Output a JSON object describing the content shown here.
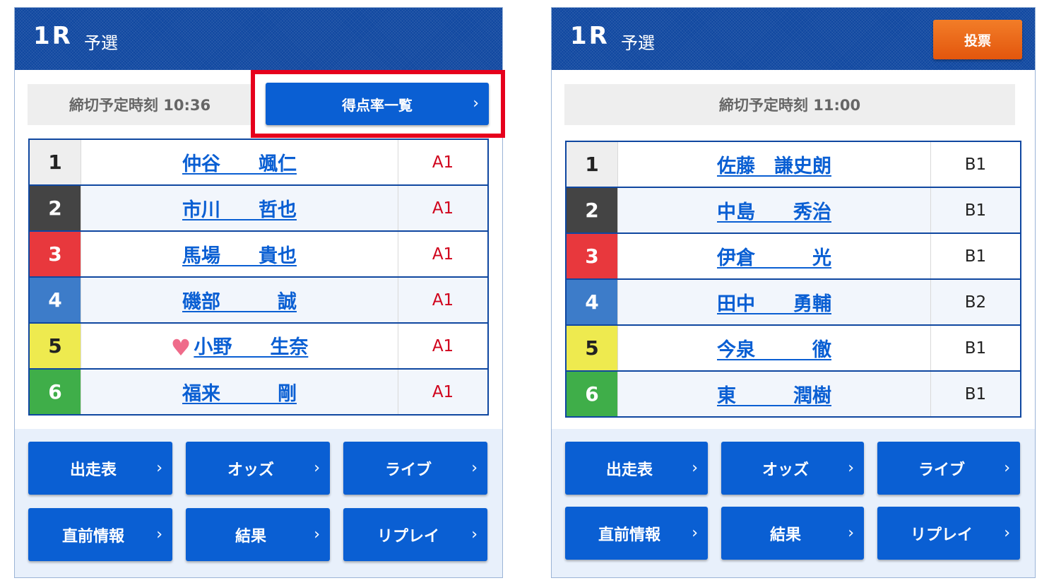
{
  "panels": [
    {
      "race_no": "1R",
      "race_name": "予選",
      "deadline": "締切予定時刻 10:36",
      "score_button": "得点率一覧",
      "entries": [
        {
          "waku": "1",
          "name": "仲谷　　颯仁",
          "grade": "A1",
          "favorite": false
        },
        {
          "waku": "2",
          "name": "市川　　哲也",
          "grade": "A1",
          "favorite": false
        },
        {
          "waku": "3",
          "name": "馬場　　貴也",
          "grade": "A1",
          "favorite": false
        },
        {
          "waku": "4",
          "name": "磯部　　　誠",
          "grade": "A1",
          "favorite": false
        },
        {
          "waku": "5",
          "name": "小野　　生奈",
          "grade": "A1",
          "favorite": true
        },
        {
          "waku": "6",
          "name": "福来　　　剛",
          "grade": "A1",
          "favorite": false
        }
      ],
      "nav": [
        "出走表",
        "オッズ",
        "ライブ",
        "直前情報",
        "結果",
        "リプレイ"
      ]
    },
    {
      "race_no": "1R",
      "race_name": "予選",
      "vote_button": "投票",
      "deadline": "締切予定時刻 11:00",
      "entries": [
        {
          "waku": "1",
          "name": "佐藤　謙史朗",
          "grade": "B1"
        },
        {
          "waku": "2",
          "name": "中島　　秀治",
          "grade": "B1"
        },
        {
          "waku": "3",
          "name": "伊倉　　　光",
          "grade": "B1"
        },
        {
          "waku": "4",
          "name": "田中　　勇輔",
          "grade": "B2"
        },
        {
          "waku": "5",
          "name": "今泉　　　徹",
          "grade": "B1"
        },
        {
          "waku": "6",
          "name": "東　　　潤樹",
          "grade": "B1"
        }
      ],
      "nav": [
        "出走表",
        "オッズ",
        "ライブ",
        "直前情報",
        "結果",
        "リプレイ"
      ]
    }
  ],
  "waku_colors": [
    {
      "bg": "#eeeeee",
      "fg": "#222222"
    },
    {
      "bg": "#444444",
      "fg": "#ffffff"
    },
    {
      "bg": "#e8383d",
      "fg": "#ffffff"
    },
    {
      "bg": "#3d7cc9",
      "fg": "#ffffff"
    },
    {
      "bg": "#eeea4f",
      "fg": "#222222"
    },
    {
      "bg": "#3fae49",
      "fg": "#ffffff"
    }
  ],
  "icons": {
    "chevron": "chevron-right-icon",
    "heart": "heart-icon"
  },
  "colors": {
    "header": "#0f47a0",
    "button": "#0a5fd3",
    "vote": "#e3560d",
    "highlight": "#e6001c"
  }
}
